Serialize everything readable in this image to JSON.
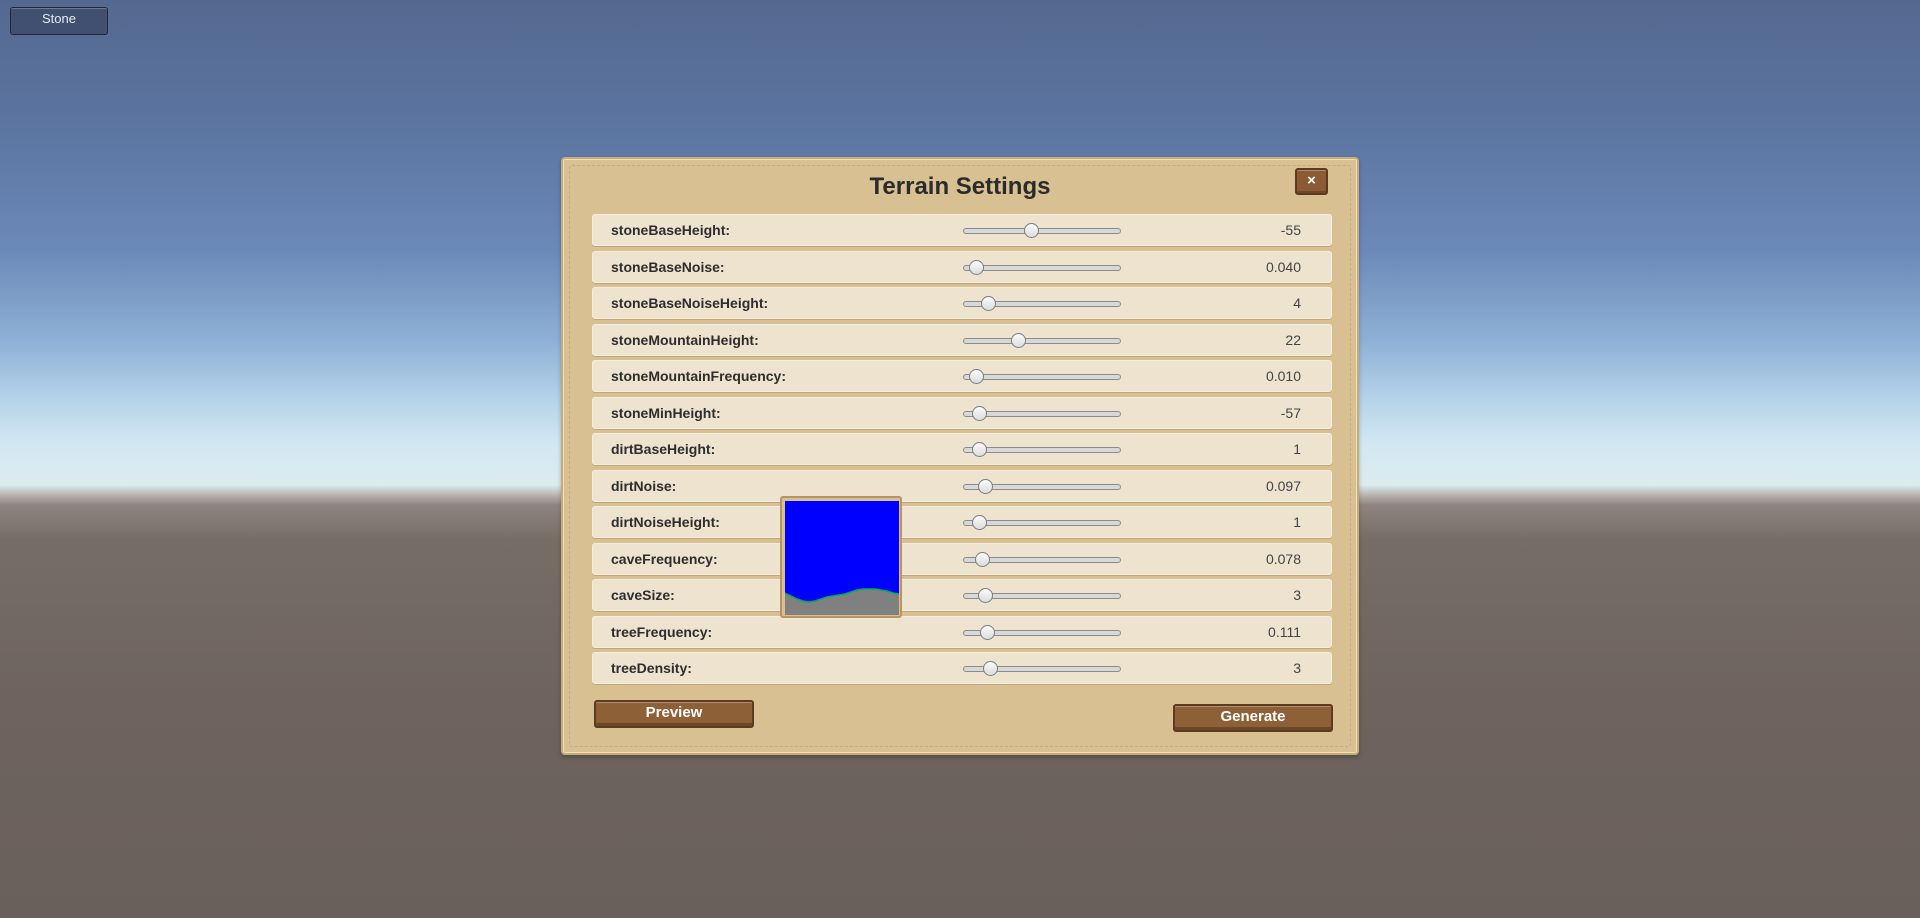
{
  "toolbar": {
    "stone_button_label": "Stone"
  },
  "panel": {
    "title": "Terrain Settings",
    "close_label": "×",
    "settings": [
      {
        "label": "stoneBaseHeight:",
        "value": "-55",
        "slider_fraction": 0.43
      },
      {
        "label": "stoneBaseNoise:",
        "value": "0.040",
        "slider_fraction": 0.08
      },
      {
        "label": "stoneBaseNoiseHeight:",
        "value": "4",
        "slider_fraction": 0.16
      },
      {
        "label": "stoneMountainHeight:",
        "value": "22",
        "slider_fraction": 0.35
      },
      {
        "label": "stoneMountainFrequency:",
        "value": "0.010",
        "slider_fraction": 0.08
      },
      {
        "label": "stoneMinHeight:",
        "value": "-57",
        "slider_fraction": 0.1
      },
      {
        "label": "dirtBaseHeight:",
        "value": "1",
        "slider_fraction": 0.1
      },
      {
        "label": "dirtNoise:",
        "value": "0.097",
        "slider_fraction": 0.14
      },
      {
        "label": "dirtNoiseHeight:",
        "value": "1",
        "slider_fraction": 0.1
      },
      {
        "label": "caveFrequency:",
        "value": "0.078",
        "slider_fraction": 0.12
      },
      {
        "label": "caveSize:",
        "value": "3",
        "slider_fraction": 0.14
      },
      {
        "label": "treeFrequency:",
        "value": "0.111",
        "slider_fraction": 0.15
      },
      {
        "label": "treeDensity:",
        "value": "3",
        "slider_fraction": 0.17
      }
    ],
    "preview_label": "Preview",
    "generate_label": "Generate"
  },
  "preview_image": {
    "sky_color": "#0000ff",
    "ground_color": "#808080",
    "surface_color": "#00b050"
  }
}
